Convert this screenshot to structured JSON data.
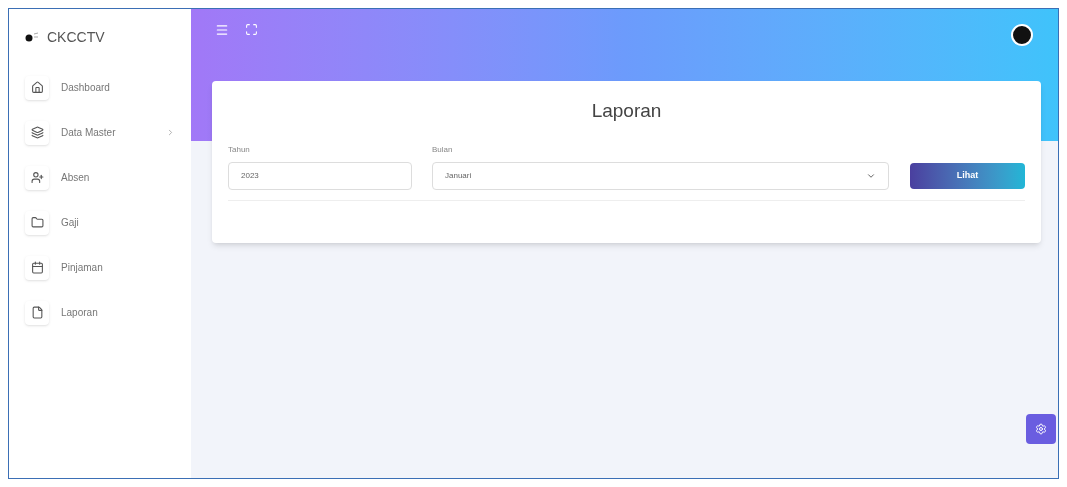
{
  "brand": "CKCCTV",
  "sidebar": {
    "items": [
      {
        "label": "Dashboard",
        "has_submenu": false
      },
      {
        "label": "Data Master",
        "has_submenu": true
      },
      {
        "label": "Absen",
        "has_submenu": false
      },
      {
        "label": "Gaji",
        "has_submenu": false
      },
      {
        "label": "Pinjaman",
        "has_submenu": false
      },
      {
        "label": "Laporan",
        "has_submenu": false
      }
    ]
  },
  "card": {
    "title": "Laporan",
    "year_field": {
      "label": "Tahun",
      "value": "2023"
    },
    "month_field": {
      "label": "Bulan",
      "value": "Januari"
    },
    "button": "Lihat"
  }
}
